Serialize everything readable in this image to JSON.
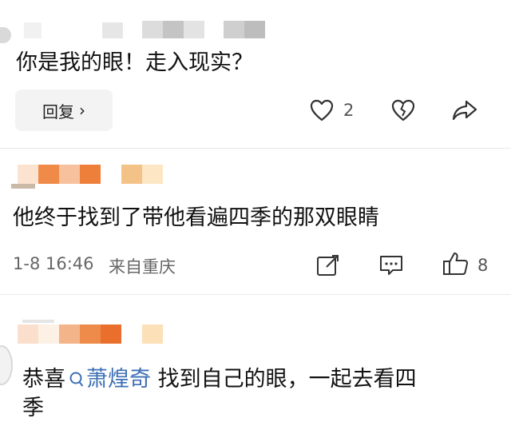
{
  "comments": [
    {
      "text": "你是我的眼！走入现实？",
      "reply_label": "回复",
      "like_count": "2"
    },
    {
      "text": "他终于找到了带他看遍四季的那双眼睛",
      "timestamp": "1-8 16:46",
      "location": "来自重庆",
      "like_count": "8"
    },
    {
      "prefix": "恭喜",
      "mention": "萧煌奇",
      "text_line1": " 找到自己的眼，一起去看四",
      "text_line2": "季"
    }
  ],
  "icons": {
    "reply_chevron": "chevron-right-icon",
    "like": "heart-icon",
    "dislike": "broken-heart-icon",
    "share": "share-icon",
    "comment": "comment-icon",
    "thumb": "thumbs-up-icon",
    "mention": "search-icon"
  },
  "colors": {
    "mention": "#3d6fb6",
    "meta_text": "#666666",
    "button_bg": "#f3f3f3"
  }
}
